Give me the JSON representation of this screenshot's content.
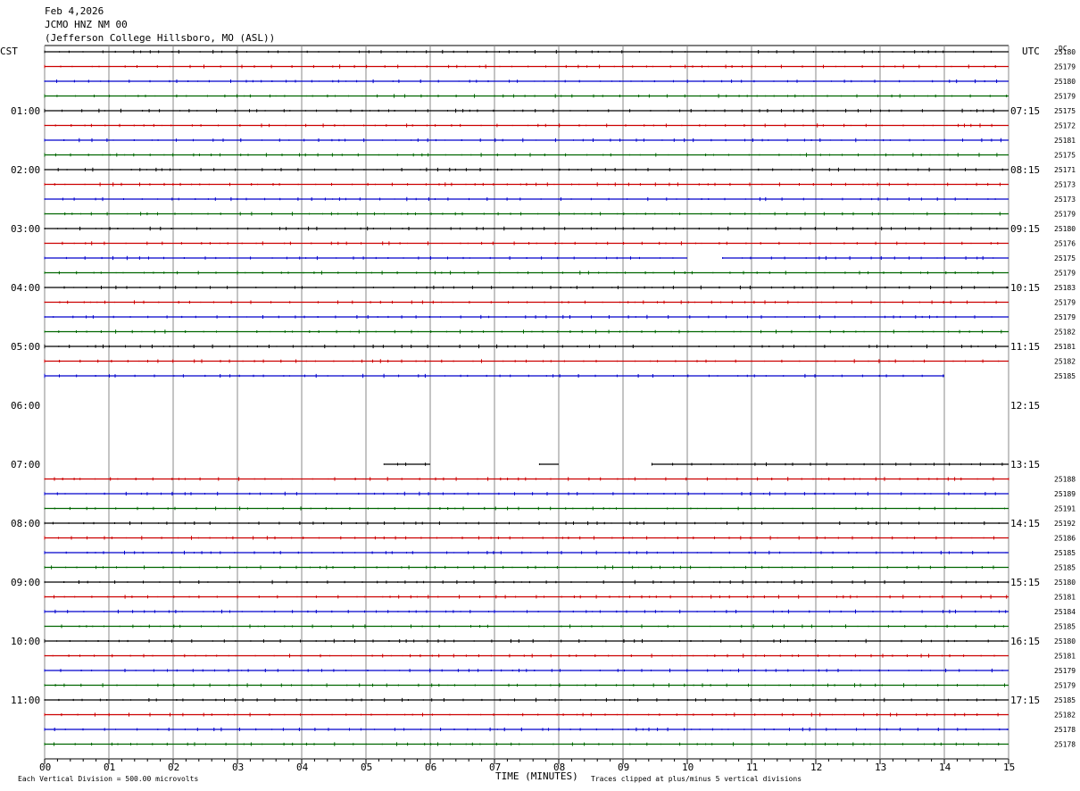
{
  "header": {
    "date": "Feb 4,2026",
    "station": "JCMO HNZ NM 00",
    "location": "(Jefferson College Hillsboro, MO (ASL))"
  },
  "left_zone": "CST",
  "right_zone": "UTC",
  "dc_label": "DC",
  "footer": {
    "scale_note": "Each Vertical Division =  500.00 microvolts",
    "clip_note": "Traces clipped at plus/minus 5 vertical divisions"
  },
  "colors": {
    "black": "#000000",
    "red": "#cc0000",
    "blue": "#0000cc",
    "green": "#006600",
    "grid": "#888888"
  },
  "chart_data": {
    "type": "line",
    "xlabel": "TIME (MINUTES)",
    "xlim": [
      0,
      15
    ],
    "x_ticks": [
      "00",
      "01",
      "02",
      "03",
      "04",
      "05",
      "06",
      "07",
      "08",
      "09",
      "10",
      "11",
      "12",
      "13",
      "14",
      "15"
    ],
    "grid": true,
    "hour_labels_left": [
      "01:00",
      "02:00",
      "03:00",
      "04:00",
      "05:00",
      "06:00",
      "07:00",
      "08:00",
      "09:00",
      "10:00",
      "11:00"
    ],
    "hour_labels_right": [
      "07:15",
      "08:15",
      "09:15",
      "10:15",
      "11:15",
      "12:15",
      "13:15",
      "14:15",
      "15:15",
      "16:15",
      "17:15"
    ],
    "trace_colors": [
      "black",
      "red",
      "blue",
      "green"
    ],
    "traces": [
      {
        "dc": "25180",
        "start": 0,
        "end": 15
      },
      {
        "dc": "25179",
        "start": 0,
        "end": 15
      },
      {
        "dc": "25180",
        "start": 0,
        "end": 15
      },
      {
        "dc": "25179",
        "start": 0,
        "end": 15
      },
      {
        "dc": "25175",
        "start": 0,
        "end": 15
      },
      {
        "dc": "25172",
        "start": 0,
        "end": 15
      },
      {
        "dc": "25181",
        "start": 0,
        "end": 15
      },
      {
        "dc": "25175",
        "start": 0,
        "end": 15
      },
      {
        "dc": "25171",
        "start": 0,
        "end": 15
      },
      {
        "dc": "25173",
        "start": 0,
        "end": 15
      },
      {
        "dc": "25173",
        "start": 0,
        "end": 15
      },
      {
        "dc": "25179",
        "start": 0,
        "end": 15
      },
      {
        "dc": "25180",
        "start": 0,
        "end": 15
      },
      {
        "dc": "25176",
        "start": 0,
        "end": 15
      },
      {
        "dc": "25175",
        "start": 0,
        "end": 15,
        "gap": [
          10.0,
          10.55
        ]
      },
      {
        "dc": "25179",
        "start": 0,
        "end": 15
      },
      {
        "dc": "25183",
        "start": 0,
        "end": 15
      },
      {
        "dc": "25179",
        "start": 0,
        "end": 15
      },
      {
        "dc": "25179",
        "start": 0,
        "end": 15
      },
      {
        "dc": "25182",
        "start": 0,
        "end": 15
      },
      {
        "dc": "25181",
        "start": 0,
        "end": 15
      },
      {
        "dc": "25182",
        "start": 0,
        "end": 15
      },
      {
        "dc": "25185",
        "start": 0,
        "end": 14.0
      },
      {
        "dc": "",
        "start": 0,
        "end": 0
      },
      {
        "dc": "",
        "start": 0,
        "end": 0
      },
      {
        "dc": "",
        "start": 0,
        "end": 0
      },
      {
        "dc": "",
        "start": 0,
        "end": 0
      },
      {
        "dc": "",
        "start": 0,
        "end": 0
      },
      {
        "dc": "",
        "segments": [
          [
            5.28,
            6.0
          ],
          [
            7.7,
            8.0
          ],
          [
            9.45,
            15
          ]
        ]
      },
      {
        "dc": "25188",
        "start": 0,
        "end": 15
      },
      {
        "dc": "25189",
        "start": 0,
        "end": 15
      },
      {
        "dc": "25191",
        "start": 0,
        "end": 15
      },
      {
        "dc": "25192",
        "start": 0,
        "end": 15
      },
      {
        "dc": "25186",
        "start": 0,
        "end": 15
      },
      {
        "dc": "25185",
        "start": 0,
        "end": 15
      },
      {
        "dc": "25185",
        "start": 0,
        "end": 15
      },
      {
        "dc": "25180",
        "start": 0,
        "end": 15
      },
      {
        "dc": "25181",
        "start": 0,
        "end": 15
      },
      {
        "dc": "25184",
        "start": 0,
        "end": 15
      },
      {
        "dc": "25185",
        "start": 0,
        "end": 15
      },
      {
        "dc": "25180",
        "start": 0,
        "end": 15
      },
      {
        "dc": "25181",
        "start": 0,
        "end": 15
      },
      {
        "dc": "25179",
        "start": 0,
        "end": 15
      },
      {
        "dc": "25179",
        "start": 0,
        "end": 15
      },
      {
        "dc": "25185",
        "start": 0,
        "end": 15
      },
      {
        "dc": "25182",
        "start": 0,
        "end": 15
      },
      {
        "dc": "25178",
        "start": 0,
        "end": 15
      },
      {
        "dc": "25178",
        "start": 0,
        "end": 15
      }
    ]
  }
}
